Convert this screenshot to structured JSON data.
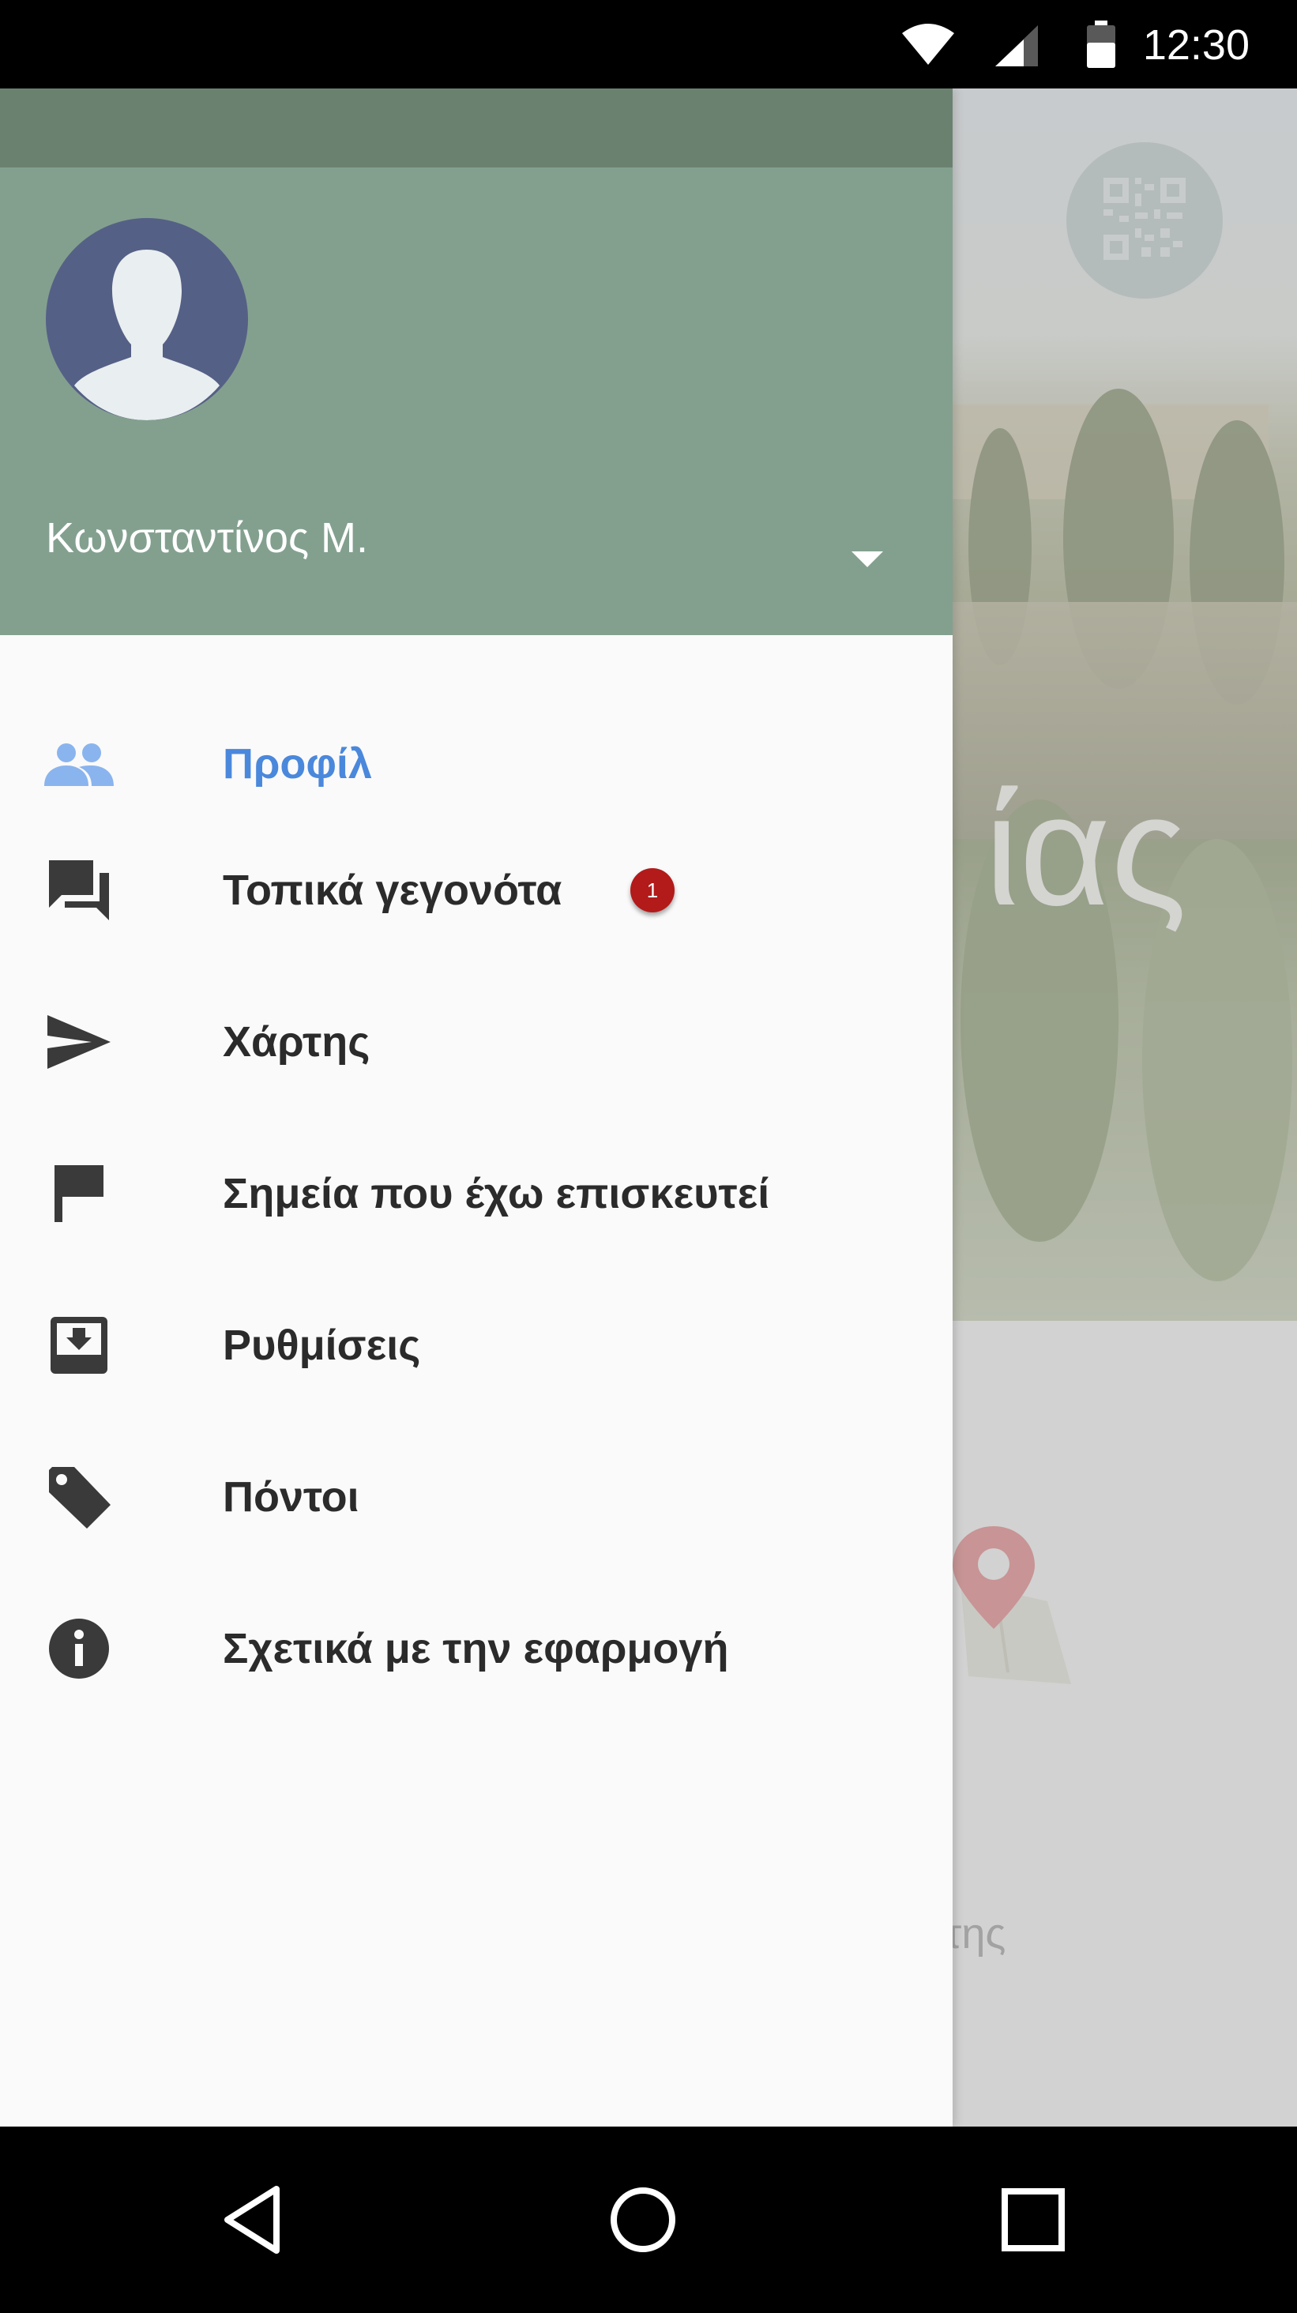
{
  "status_bar": {
    "time": "12:30",
    "icons": [
      "wifi-icon",
      "cellular-signal-icon",
      "battery-icon"
    ]
  },
  "background_app": {
    "hero_text": "ίας",
    "caption_text": "της",
    "qr_button_icon": "qr-code-icon",
    "map_pin_icon": "map-pin-icon"
  },
  "drawer": {
    "header": {
      "account_name": "Κωνσταντίνος Μ.",
      "avatar_icon": "person-avatar-icon",
      "dropdown_icon": "triangle-down-icon",
      "color": "#83a08f"
    },
    "items": [
      {
        "label": "Προφίλ",
        "icon": "people-icon",
        "active": true
      },
      {
        "label": "Τοπικά γεγονότα",
        "icon": "forum-icon",
        "badge": "1"
      },
      {
        "label": "Χάρτης",
        "icon": "send-icon"
      },
      {
        "label": "Σημεία που έχω επισκευτεί",
        "icon": "flag-icon"
      },
      {
        "label": "Ρυθμίσεις",
        "icon": "archive-icon"
      },
      {
        "label": "Πόντοι",
        "icon": "tag-icon"
      },
      {
        "label": "Σχετικά με την εφαρμογή",
        "icon": "info-icon"
      }
    ],
    "active_color": "#4a88dc",
    "badge_color": "#b31a1a"
  },
  "nav_bar": {
    "buttons": [
      "back-icon",
      "home-icon",
      "recents-icon"
    ]
  }
}
